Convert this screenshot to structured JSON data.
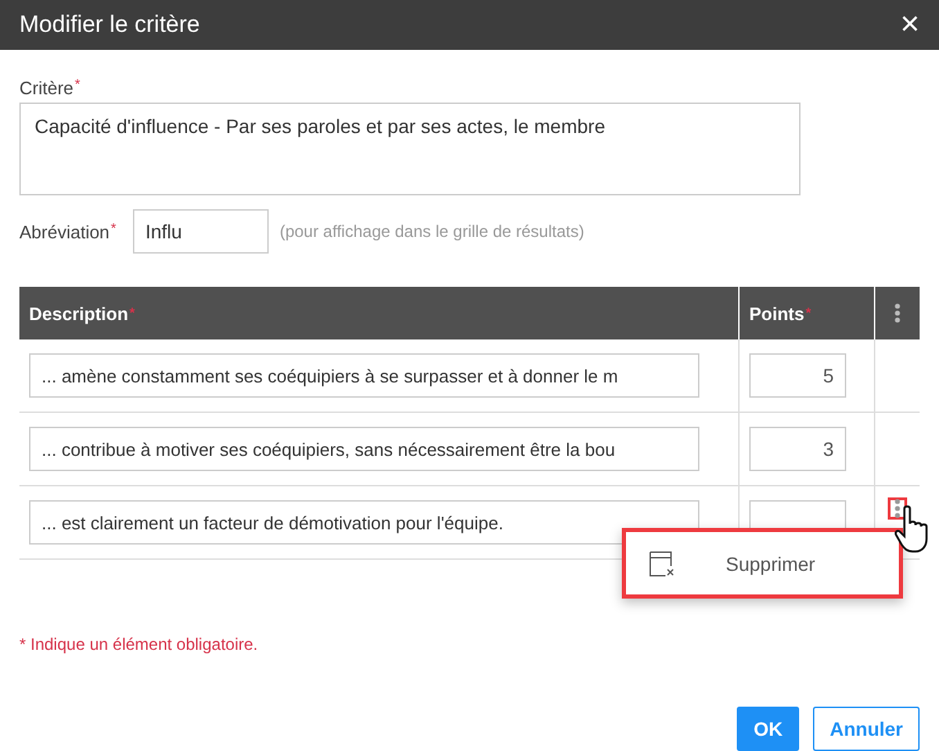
{
  "window": {
    "title": "Modifier le critère",
    "close": "×"
  },
  "criterion": {
    "label": "Critère",
    "required_mark": "*",
    "value": "Capacité d'influence  -  Par ses paroles et par ses actes, le membre"
  },
  "abbreviation": {
    "label": "Abréviation",
    "required_mark": "*",
    "value": "Influ",
    "hint": "(pour affichage dans le grille de résultats)"
  },
  "table": {
    "columns": [
      {
        "label": "Description",
        "required_mark": "*"
      },
      {
        "label": "Points",
        "required_mark": "*"
      }
    ],
    "rows": [
      {
        "description": "... amène constamment ses coéquipiers à se surpasser et à donner le m",
        "points": "5",
        "menu_open": false
      },
      {
        "description": "... contribue à motiver ses coéquipiers, sans nécessairement être la bou",
        "points": "3",
        "menu_open": false
      },
      {
        "description": "... est clairement un facteur de démotivation pour l'équipe.",
        "points": "",
        "menu_open": true
      }
    ]
  },
  "context_menu": {
    "items": [
      {
        "label": "Supprimer"
      }
    ]
  },
  "required_note": "* Indique un élément obligatoire.",
  "buttons": [
    {
      "label": "OK",
      "kind": "primary"
    },
    {
      "label": "Annuler",
      "kind": "secondary"
    }
  ]
}
